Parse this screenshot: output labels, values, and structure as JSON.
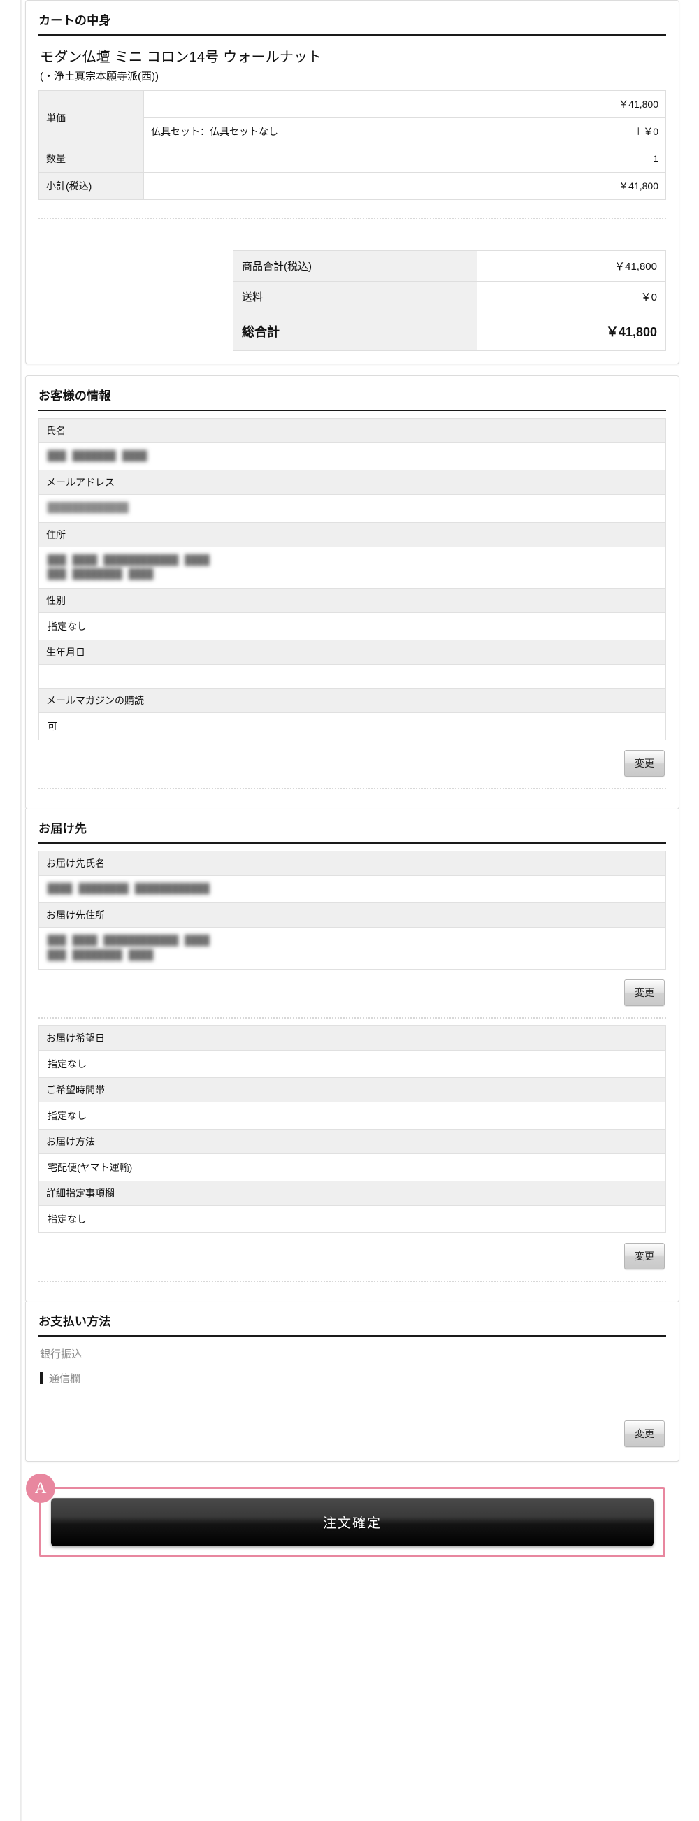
{
  "cart": {
    "section_title": "カートの中身",
    "product_name": "モダン仏壇 ミニ コロン14号 ウォールナット",
    "product_sub": "(・浄土真宗本願寺派(西))",
    "rows": {
      "unit_price_label": "単価",
      "unit_price_value": "￥41,800",
      "option_label": "仏具セット：仏具セットなし",
      "option_value": "＋￥0",
      "quantity_label": "数量",
      "quantity_value": "1",
      "subtotal_label": "小計(税込)",
      "subtotal_value": "￥41,800"
    },
    "totals": [
      {
        "label": "商品合計(税込)",
        "amount": "￥41,800"
      },
      {
        "label": "送料",
        "amount": "￥0"
      }
    ],
    "grand_total": {
      "label": "総合計",
      "amount": "￥41,800"
    }
  },
  "customer": {
    "section_title": "お客様の情報",
    "fields": [
      {
        "label": "氏名",
        "value": "███ ███████ ████",
        "redacted": true
      },
      {
        "label": "メールアドレス",
        "value": "█████████████",
        "redacted": true
      },
      {
        "label": "住所",
        "value": "███ ████ ████████████ ████\n███ ████████ ████",
        "redacted": true
      },
      {
        "label": "性別",
        "value": "指定なし",
        "redacted": false
      },
      {
        "label": "生年月日",
        "value": "",
        "redacted": false
      },
      {
        "label": "メールマガジンの購読",
        "value": "可",
        "redacted": false
      }
    ],
    "change_button": "変更"
  },
  "shipping": {
    "section_title": "お届け先",
    "address_fields": [
      {
        "label": "お届け先氏名",
        "value": "████ ████████ ████████████",
        "redacted": true
      },
      {
        "label": "お届け先住所",
        "value": "███ ████ ████████████ ████\n███ ████████ ████",
        "redacted": true
      }
    ],
    "change_button_1": "変更",
    "option_fields": [
      {
        "label": "お届け希望日",
        "value": "指定なし"
      },
      {
        "label": "ご希望時間帯",
        "value": "指定なし"
      },
      {
        "label": "お届け方法",
        "value": "宅配便(ヤマト運輸)"
      },
      {
        "label": "詳細指定事項欄",
        "value": "指定なし"
      }
    ],
    "change_button_2": "変更"
  },
  "payment": {
    "section_title": "お支払い方法",
    "method": "銀行振込",
    "memo_label": "通信欄",
    "change_button": "変更"
  },
  "order": {
    "confirm_button": "注文確定",
    "annotation_badge": "A",
    "annotation_color": "#e8879f"
  }
}
